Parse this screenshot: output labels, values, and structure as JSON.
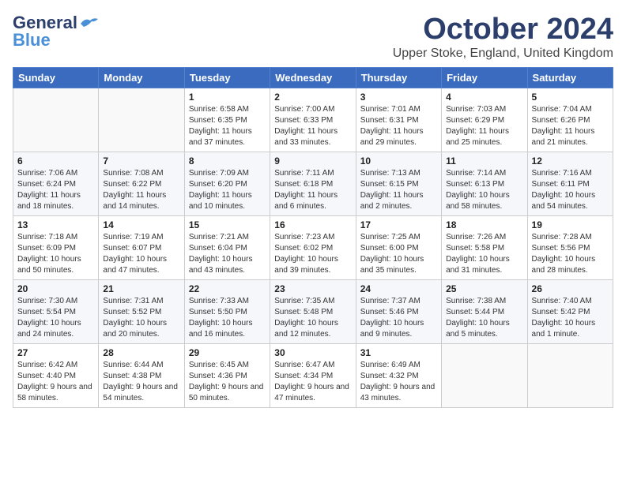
{
  "header": {
    "logo_general": "General",
    "logo_blue": "Blue",
    "month": "October 2024",
    "location": "Upper Stoke, England, United Kingdom"
  },
  "weekdays": [
    "Sunday",
    "Monday",
    "Tuesday",
    "Wednesday",
    "Thursday",
    "Friday",
    "Saturday"
  ],
  "weeks": [
    [
      {
        "day": "",
        "info": ""
      },
      {
        "day": "",
        "info": ""
      },
      {
        "day": "1",
        "info": "Sunrise: 6:58 AM\nSunset: 6:35 PM\nDaylight: 11 hours and 37 minutes."
      },
      {
        "day": "2",
        "info": "Sunrise: 7:00 AM\nSunset: 6:33 PM\nDaylight: 11 hours and 33 minutes."
      },
      {
        "day": "3",
        "info": "Sunrise: 7:01 AM\nSunset: 6:31 PM\nDaylight: 11 hours and 29 minutes."
      },
      {
        "day": "4",
        "info": "Sunrise: 7:03 AM\nSunset: 6:29 PM\nDaylight: 11 hours and 25 minutes."
      },
      {
        "day": "5",
        "info": "Sunrise: 7:04 AM\nSunset: 6:26 PM\nDaylight: 11 hours and 21 minutes."
      }
    ],
    [
      {
        "day": "6",
        "info": "Sunrise: 7:06 AM\nSunset: 6:24 PM\nDaylight: 11 hours and 18 minutes."
      },
      {
        "day": "7",
        "info": "Sunrise: 7:08 AM\nSunset: 6:22 PM\nDaylight: 11 hours and 14 minutes."
      },
      {
        "day": "8",
        "info": "Sunrise: 7:09 AM\nSunset: 6:20 PM\nDaylight: 11 hours and 10 minutes."
      },
      {
        "day": "9",
        "info": "Sunrise: 7:11 AM\nSunset: 6:18 PM\nDaylight: 11 hours and 6 minutes."
      },
      {
        "day": "10",
        "info": "Sunrise: 7:13 AM\nSunset: 6:15 PM\nDaylight: 11 hours and 2 minutes."
      },
      {
        "day": "11",
        "info": "Sunrise: 7:14 AM\nSunset: 6:13 PM\nDaylight: 10 hours and 58 minutes."
      },
      {
        "day": "12",
        "info": "Sunrise: 7:16 AM\nSunset: 6:11 PM\nDaylight: 10 hours and 54 minutes."
      }
    ],
    [
      {
        "day": "13",
        "info": "Sunrise: 7:18 AM\nSunset: 6:09 PM\nDaylight: 10 hours and 50 minutes."
      },
      {
        "day": "14",
        "info": "Sunrise: 7:19 AM\nSunset: 6:07 PM\nDaylight: 10 hours and 47 minutes."
      },
      {
        "day": "15",
        "info": "Sunrise: 7:21 AM\nSunset: 6:04 PM\nDaylight: 10 hours and 43 minutes."
      },
      {
        "day": "16",
        "info": "Sunrise: 7:23 AM\nSunset: 6:02 PM\nDaylight: 10 hours and 39 minutes."
      },
      {
        "day": "17",
        "info": "Sunrise: 7:25 AM\nSunset: 6:00 PM\nDaylight: 10 hours and 35 minutes."
      },
      {
        "day": "18",
        "info": "Sunrise: 7:26 AM\nSunset: 5:58 PM\nDaylight: 10 hours and 31 minutes."
      },
      {
        "day": "19",
        "info": "Sunrise: 7:28 AM\nSunset: 5:56 PM\nDaylight: 10 hours and 28 minutes."
      }
    ],
    [
      {
        "day": "20",
        "info": "Sunrise: 7:30 AM\nSunset: 5:54 PM\nDaylight: 10 hours and 24 minutes."
      },
      {
        "day": "21",
        "info": "Sunrise: 7:31 AM\nSunset: 5:52 PM\nDaylight: 10 hours and 20 minutes."
      },
      {
        "day": "22",
        "info": "Sunrise: 7:33 AM\nSunset: 5:50 PM\nDaylight: 10 hours and 16 minutes."
      },
      {
        "day": "23",
        "info": "Sunrise: 7:35 AM\nSunset: 5:48 PM\nDaylight: 10 hours and 12 minutes."
      },
      {
        "day": "24",
        "info": "Sunrise: 7:37 AM\nSunset: 5:46 PM\nDaylight: 10 hours and 9 minutes."
      },
      {
        "day": "25",
        "info": "Sunrise: 7:38 AM\nSunset: 5:44 PM\nDaylight: 10 hours and 5 minutes."
      },
      {
        "day": "26",
        "info": "Sunrise: 7:40 AM\nSunset: 5:42 PM\nDaylight: 10 hours and 1 minute."
      }
    ],
    [
      {
        "day": "27",
        "info": "Sunrise: 6:42 AM\nSunset: 4:40 PM\nDaylight: 9 hours and 58 minutes."
      },
      {
        "day": "28",
        "info": "Sunrise: 6:44 AM\nSunset: 4:38 PM\nDaylight: 9 hours and 54 minutes."
      },
      {
        "day": "29",
        "info": "Sunrise: 6:45 AM\nSunset: 4:36 PM\nDaylight: 9 hours and 50 minutes."
      },
      {
        "day": "30",
        "info": "Sunrise: 6:47 AM\nSunset: 4:34 PM\nDaylight: 9 hours and 47 minutes."
      },
      {
        "day": "31",
        "info": "Sunrise: 6:49 AM\nSunset: 4:32 PM\nDaylight: 9 hours and 43 minutes."
      },
      {
        "day": "",
        "info": ""
      },
      {
        "day": "",
        "info": ""
      }
    ]
  ]
}
